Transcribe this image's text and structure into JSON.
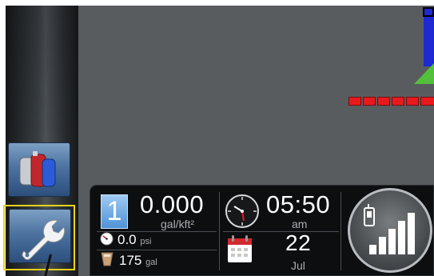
{
  "left_rail": {
    "buttons": [
      {
        "name": "product-tanks",
        "icon": "product-tanks-icon"
      },
      {
        "name": "tools",
        "icon": "wrench-icon",
        "highlighted": true
      }
    ]
  },
  "status_bar": {
    "section": "1",
    "rate_value": "0.000",
    "rate_unit": "gal/kft²",
    "pressure_value": "0.0",
    "pressure_unit": "psi",
    "tank_value": "175",
    "tank_unit": "gal",
    "time_value": "05:50",
    "time_period": "am",
    "date_day": "22",
    "date_month": "Jul"
  },
  "colors": {
    "boom_active": "#e8191d",
    "map_background": "#595c5f",
    "highlight": "#e8d21c",
    "badge_blue": "#4f93d6"
  }
}
